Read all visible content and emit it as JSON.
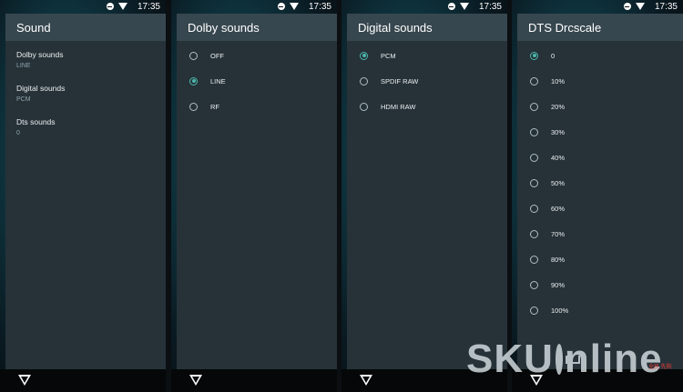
{
  "status": {
    "time": "17:35"
  },
  "sound_panel": {
    "title": "Sound",
    "items": [
      {
        "title": "Dolby sounds",
        "summary": "LINE"
      },
      {
        "title": "Digital sounds",
        "summary": "PCM"
      },
      {
        "title": "Dts sounds",
        "summary": "0"
      }
    ]
  },
  "dolby_panel": {
    "title": "Dolby sounds",
    "options": [
      {
        "label": "OFF",
        "checked": false
      },
      {
        "label": "LINE",
        "checked": true
      },
      {
        "label": "RF",
        "checked": false
      }
    ]
  },
  "digital_panel": {
    "title": "Digital sounds",
    "options": [
      {
        "label": "PCM",
        "checked": true
      },
      {
        "label": "SPDIF RAW",
        "checked": false
      },
      {
        "label": "HDMI RAW",
        "checked": false
      }
    ]
  },
  "dts_panel": {
    "title": "DTS Drcscale",
    "options": [
      {
        "label": "0",
        "checked": true
      },
      {
        "label": "10%",
        "checked": false
      },
      {
        "label": "20%",
        "checked": false
      },
      {
        "label": "30%",
        "checked": false
      },
      {
        "label": "40%",
        "checked": false
      },
      {
        "label": "50%",
        "checked": false
      },
      {
        "label": "60%",
        "checked": false
      },
      {
        "label": "70%",
        "checked": false
      },
      {
        "label": "80%",
        "checked": false
      },
      {
        "label": "90%",
        "checked": false
      },
      {
        "label": "100%",
        "checked": false
      }
    ]
  },
  "watermark": {
    "text_left": "SKU",
    "text_right": "nline",
    "sub": "全民   先购"
  },
  "colors": {
    "accent": "#4db6ac",
    "card": "#263238",
    "header": "#37474f"
  }
}
